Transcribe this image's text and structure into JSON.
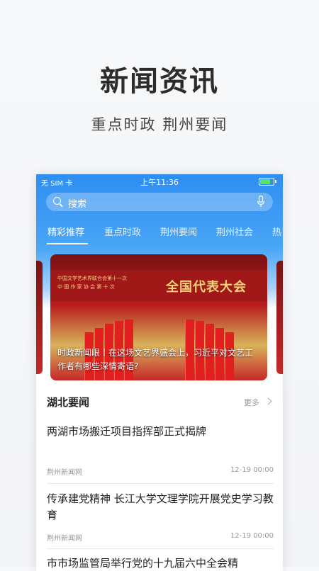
{
  "promo": {
    "title": "新闻资讯",
    "subtitle": "重点时政  荆州要闻"
  },
  "status_bar": {
    "carrier": "无 SIM 卡",
    "time": "上午11:36",
    "battery_level": 0.85
  },
  "search": {
    "placeholder": "搜索"
  },
  "tabs": [
    {
      "label": "精彩推荐",
      "active": true
    },
    {
      "label": "重点时政",
      "active": false
    },
    {
      "label": "荆州要闻",
      "active": false
    },
    {
      "label": "荆州社会",
      "active": false
    },
    {
      "label": "热",
      "active": false
    }
  ],
  "carousel": {
    "banner_line1": "中国文学艺术界联合会第十一次",
    "banner_line2": "中 国 作 家 协 会 第 十 次",
    "banner_big": "全国代表大会",
    "caption": "时政新闻眼丨在这场文艺界盛会上，习近平对文艺工作者有哪些深情寄语?"
  },
  "section": {
    "title": "湖北要闻",
    "more_label": "更多"
  },
  "news": [
    {
      "title": "两湖市场搬迁项目指挥部正式揭牌",
      "source": "荆州新闻网",
      "time": "12-19 00:00"
    },
    {
      "title": "传承建党精神 长江大学文理学院开展党史学习教育",
      "source": "荆州新闻网",
      "time": "12-19 00:00"
    },
    {
      "title": "市市场监管局举行党的十九届六中全会精"
    }
  ],
  "colors": {
    "accent_blue": "#2e8df2",
    "banner_red": "#c62828"
  }
}
